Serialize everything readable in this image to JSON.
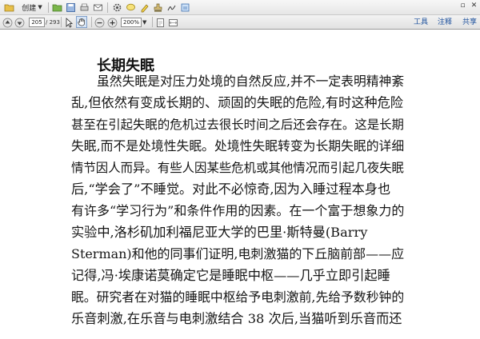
{
  "toolbar": {
    "create_label": "创建",
    "right_links": [
      "工具",
      "注释",
      "共享"
    ]
  },
  "navigation": {
    "page_current": "205",
    "page_total": "/ 293",
    "zoom": "200%"
  },
  "document": {
    "title": "长期失眠",
    "lines": [
      "虽然失眠是对压力处境的自然反应,并不一定表明精神紊",
      "乱,但依然有变成长期的、顽固的失眠的危险,有时这种危险",
      "甚至在引起失眠的危机过去很长时间之后还会存在。这是长期",
      "失眠,而不是处境性失眠。处境性失眠转变为长期失眠的详细",
      "情节因人而异。有些人因某些危机或其他情况而引起几夜失眠",
      "后,“学会了”不睡觉。对此不必惊奇,因为入睡过程本身也",
      "有许多“学习行为”和条件作用的因素。在一个富于想象力的",
      "实验中,洛杉矶加利福尼亚大学的巴里·斯特曼(Barry",
      "Sterman)和他的同事们证明,电刺激猫的下丘脑前部——应",
      "记得,冯·埃康诺莫确定它是睡眠中枢——几乎立即引起睡",
      "眠。研究者在对猫的睡眠中枢给予电刺激前,先给予数秒钟的",
      "乐音刺激,在乐音与电刺激结合 38 次后,当猫听到乐音而还"
    ]
  }
}
